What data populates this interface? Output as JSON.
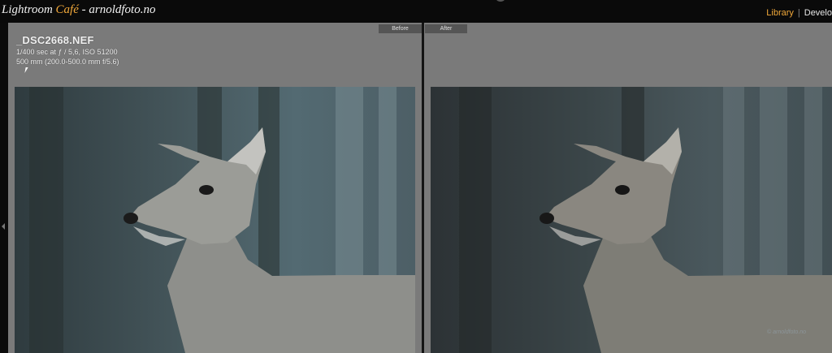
{
  "brand": {
    "name": "Lightroom",
    "cafe": "Café",
    "site": " - arnoldfoto.no"
  },
  "modules": {
    "library": "Library",
    "separator": "|",
    "develop": "Develo"
  },
  "compare": {
    "before_label": "Before",
    "after_label": "After"
  },
  "photo_info": {
    "filename": "_DSC2668.NEF",
    "exposure": "1/400 sec at ƒ / 5,6, ISO 51200",
    "lens": "500 mm (200.0-500.0 mm f/5.6)"
  },
  "colors": {
    "accent": "#f2a93a",
    "background": "#7a7a7a",
    "topbar": "#0a0a0a"
  },
  "icons": [
    "left-panel-arrow-icon"
  ],
  "watermark": "© arnoldfoto.no"
}
